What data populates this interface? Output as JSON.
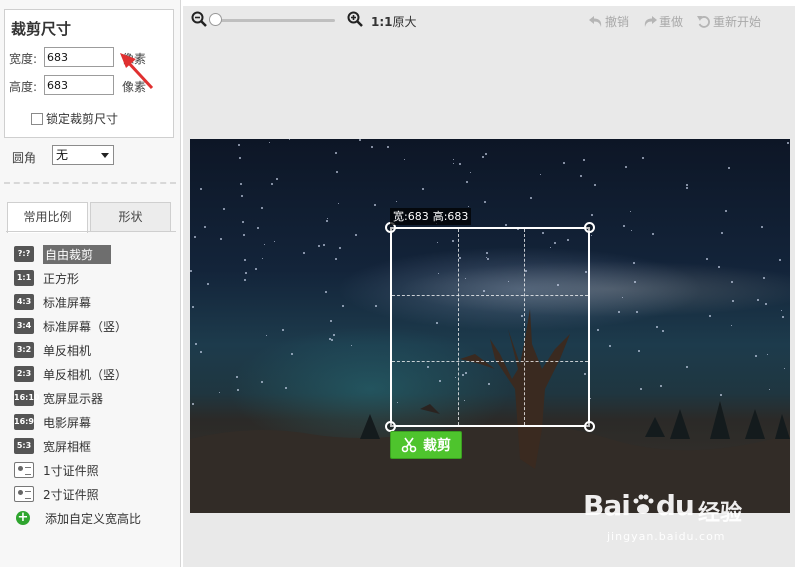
{
  "size_panel": {
    "title": "裁剪尺寸",
    "width_label": "宽度:",
    "width_value": "683",
    "height_label": "高度:",
    "height_value": "683",
    "unit": "像素",
    "lock_label": "锁定裁剪尺寸",
    "lock_checked": false
  },
  "corner": {
    "label": "圆角",
    "selected": "无"
  },
  "tabs": [
    {
      "label": "常用比例",
      "active": true
    },
    {
      "label": "形状",
      "active": false
    }
  ],
  "ratios": [
    {
      "badge": "?:?",
      "label": "自由裁剪",
      "selected": true,
      "icon": "free-ratio-icon"
    },
    {
      "badge": "1:1",
      "label": "正方形",
      "icon": "ratio-icon"
    },
    {
      "badge": "4:3",
      "label": "标准屏幕",
      "icon": "ratio-icon"
    },
    {
      "badge": "3:4",
      "label": "标准屏幕（竖）",
      "icon": "ratio-icon"
    },
    {
      "badge": "3:2",
      "label": "单反相机",
      "icon": "ratio-icon"
    },
    {
      "badge": "2:3",
      "label": "单反相机（竖）",
      "icon": "ratio-icon"
    },
    {
      "badge": "16:10",
      "label": "宽屏显示器",
      "icon": "ratio-icon"
    },
    {
      "badge": "16:9",
      "label": "电影屏幕",
      "icon": "ratio-icon"
    },
    {
      "badge": "5:3",
      "label": "宽屏相框",
      "icon": "ratio-icon"
    },
    {
      "badge": "",
      "label": "1寸证件照",
      "icon": "id-photo-icon"
    },
    {
      "badge": "",
      "label": "2寸证件照",
      "icon": "id-photo-icon"
    }
  ],
  "add_custom": {
    "label": "添加自定义宽高比",
    "icon": "plus-circle-icon"
  },
  "toolbar": {
    "zoom_out_icon": "zoom-out-icon",
    "zoom_in_icon": "zoom-in-icon",
    "zoom_level": 0.0,
    "original_bold": "1:1",
    "original_label": "原大",
    "undo_label": "撤销",
    "redo_label": "重做",
    "restart_label": "重新开始"
  },
  "canvas": {
    "dims_width": "宽:683",
    "dims_height": "高:683",
    "crop_button_label": "裁剪",
    "crop_icon": "scissors-icon"
  },
  "watermark": {
    "brand": "Bai",
    "brand_end": "du",
    "product": "经验",
    "url": "jingyan.baidu.com"
  },
  "colors": {
    "crop_button": "#4ec42d",
    "selected_item": "#6e6e6e",
    "annotation_arrow": "#e03030"
  }
}
